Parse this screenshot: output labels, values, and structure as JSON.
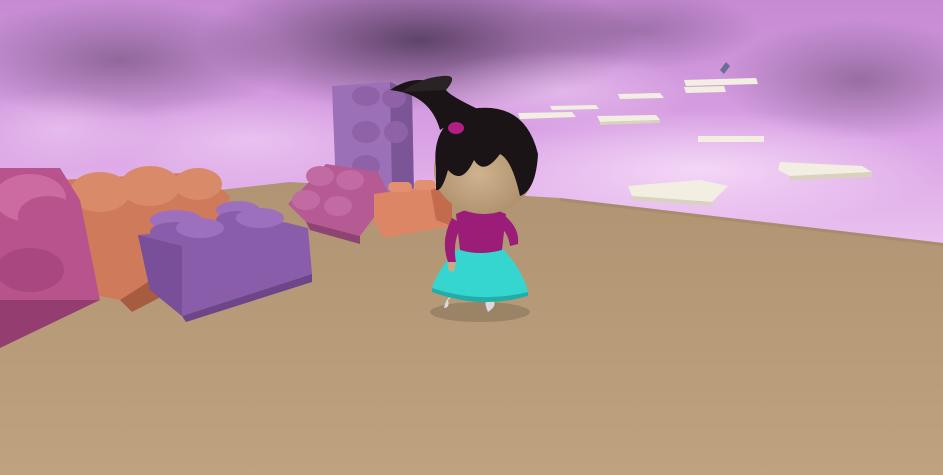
{
  "scene": {
    "type": "3d-platformer-scene",
    "sky": {
      "base": "#d99be6",
      "light": "#f0c9f5",
      "dark": "#5a3f66",
      "mid": "#b07cc4"
    },
    "ground": {
      "color": "#b89c7a",
      "shadow": "#9c8265"
    },
    "character": {
      "hair": "#1b1416",
      "skin": "#c8ab86",
      "shirt": "#9c1d78",
      "skirt": "#35d6d0",
      "shoe": "#d9d9df"
    },
    "blocks": [
      {
        "name": "magenta-brick",
        "color": "#b8538d"
      },
      {
        "name": "orange-brick-large",
        "color": "#cf7a5a"
      },
      {
        "name": "purple-brick-front",
        "color": "#8a5dab"
      },
      {
        "name": "purple-brick-upright",
        "color": "#9c70b6"
      },
      {
        "name": "pink-brick",
        "color": "#b65a94"
      },
      {
        "name": "orange-brick-small",
        "color": "#dd8666"
      }
    ],
    "platforms": {
      "color": "#f2efe2",
      "side": "#d8d2bf",
      "count": 9
    },
    "distant-item": {
      "color": "#6a6f96"
    }
  }
}
